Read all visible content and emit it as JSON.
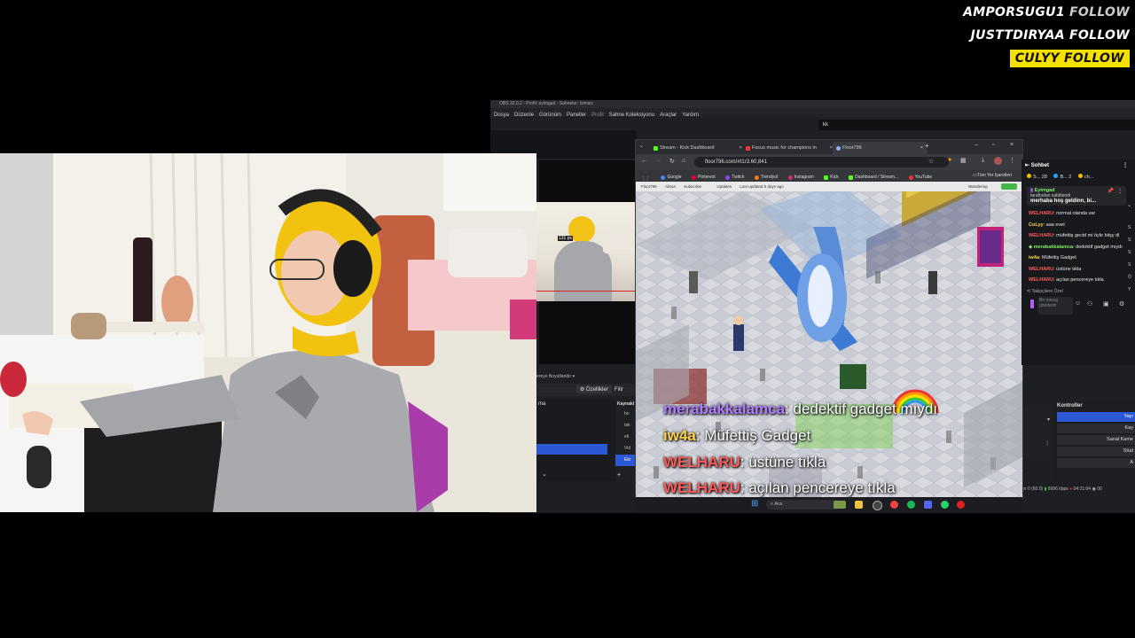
{
  "follows": [
    {
      "name": "AMPORSUGU1",
      "action": "FOLLOW",
      "highlight": false
    },
    {
      "name": "JUSTTDIRYAA",
      "action": "FOLLOW",
      "highlight": false
    },
    {
      "name": "CULYY",
      "action": "FOLLOW",
      "highlight": true
    }
  ],
  "obs": {
    "title": "OBS 32.0.2 - Profil: eyimgad - Sahneler: İsimsiz",
    "menu": [
      "Dosya",
      "Düzenle",
      "Görünüm",
      "Paneller",
      "Profil",
      "Sahne Koleksiyonu",
      "Araçlar",
      "Yardım"
    ],
    "kick_label": "kk",
    "props_button": "Özellikler",
    "filters_button": "Filtr",
    "scene_label": "ma",
    "sources_header": "Kaynakl",
    "sources": [
      "bo",
      "tak",
      "eti",
      "Vid",
      "Ekr"
    ],
    "blend_label": "ereye Boyutlandır",
    "canvas_size": "131 px",
    "controls_header": "Kontroller",
    "controls": [
      "Yayı",
      "Kay",
      "Sanal Kame",
      "Stüd",
      "A"
    ],
    "status_fps": "ler 0 (60.0)",
    "status_kbps": "6996 kbps",
    "status_time": "04:21:04",
    "status_extra": "00"
  },
  "browser": {
    "tabs": [
      "Stream - Kick Dashboard",
      "Focus music for champions in",
      "Floor796"
    ],
    "new_tab": "+",
    "url": "floor796.com/#t1r3.60,841",
    "bookmarks": [
      "Google",
      "Pinterest",
      "Twitch",
      "Trendyol",
      "Instagram",
      "Kick",
      "Dashboard / Stream...",
      "YouTube"
    ],
    "bookmarks_all": "Tüm Yer İşaretleri",
    "site_nav": [
      "Floor796",
      "About",
      "Subscribe",
      "Updates",
      "Last updated",
      "5",
      "days ago"
    ],
    "site_wandering": "Wandering"
  },
  "chat": {
    "header": "Sohbet",
    "top_items": [
      {
        "label": "S...",
        "count": "28",
        "color": "#f0c000"
      },
      {
        "label": "B...",
        "count": "2",
        "color": "#2aa0ff"
      },
      {
        "label": "ch...",
        "count": "",
        "color": "#f0c000"
      }
    ],
    "pinned_header": "Eyimgad",
    "pinned_by": "tarafından sabitlendi",
    "pinned_text": "merhaba hoş geldinn, bi...",
    "messages": [
      {
        "user": "WELHARU",
        "text": "normal olanda var",
        "color": "#ff5a5a"
      },
      {
        "user": "CuLyy",
        "text": "aaa evet",
        "color": "#ffd24a"
      },
      {
        "user": "WELHARU",
        "text": "müfettiş gecid mi öyle biişy di",
        "color": "#ff5a5a"
      },
      {
        "user": "merabakkalamca",
        "text": "dedektif gadget mıydı",
        "color": "#7cf062"
      },
      {
        "user": "iw4a",
        "text": "Müfettiş Gadget",
        "color": "#ffd24a"
      },
      {
        "user": "WELHARU",
        "text": "üstüne tıkla",
        "color": "#ff5a5a"
      },
      {
        "user": "WELHARU",
        "text": "açılan pencereye tıkla",
        "color": "#ff5a5a"
      }
    ],
    "followers_only": "Takipçilere Özel",
    "input_placeholder": "Bir mesaj gönderin",
    "edge_letters": [
      "S",
      "S",
      "S",
      "S",
      "Ö",
      "Y"
    ]
  },
  "overlay_chat": [
    {
      "user": "merabakkalamca",
      "text": "dedektif gadget mıydı"
    },
    {
      "user": "iw4a",
      "text": "Müfettiş Gadget"
    },
    {
      "user": "WELHARU",
      "text": "üstüne tıkla"
    },
    {
      "user": "WELHARU",
      "text": "açılan pencereye tıkla"
    }
  ],
  "taskbar": {
    "search": "Ara"
  },
  "colors": {
    "obs_bg": "#1e1f23",
    "kick_green": "#53fc18",
    "follow_yellow": "#f5e100",
    "obs_selected": "#2c58d6"
  }
}
